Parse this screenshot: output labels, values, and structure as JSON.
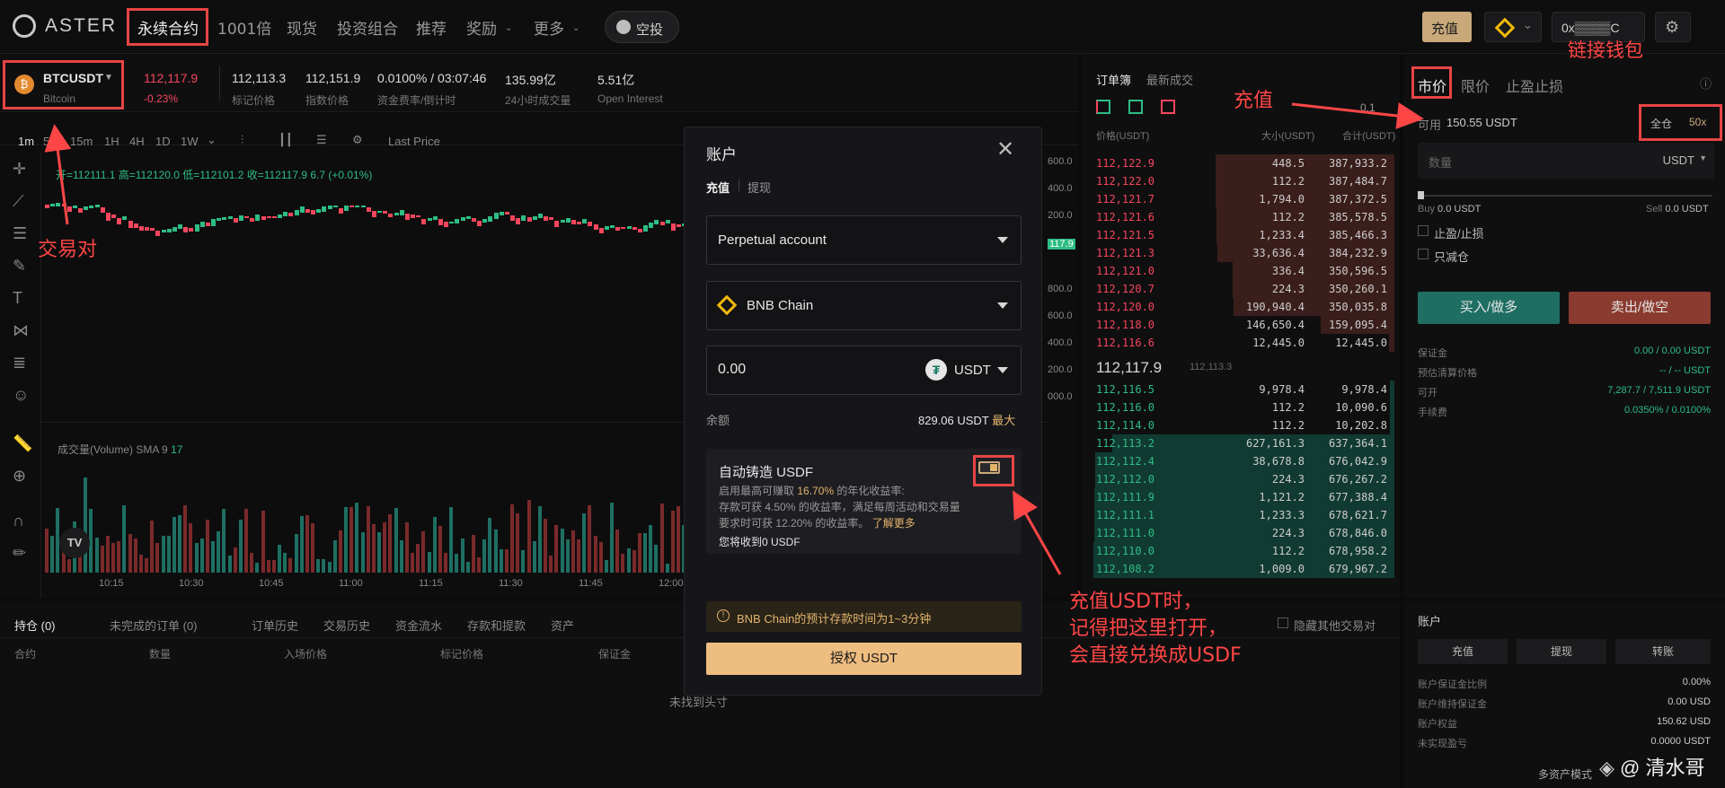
{
  "nav": {
    "logo": "ASTER",
    "items": [
      "永续合约",
      "1001倍",
      "现货",
      "投资组合",
      "推荐",
      "奖励",
      "更多"
    ],
    "airdrop": "空投",
    "deposit": "充值",
    "wallet": "0x▒▒▒▒C"
  },
  "ticker": {
    "symbol": "BTCUSDT",
    "name": "Bitcoin",
    "price": "112,117.9",
    "change": "-0.23%",
    "mark": "112,113.3",
    "mark_label": "标记价格",
    "index": "112,151.9",
    "index_label": "指数价格",
    "funding": "0.0100% / 03:07:46",
    "funding_label": "资金费率/倒计时",
    "vol": "135.99亿",
    "vol_label": "24小时成交量",
    "oi": "5.51亿",
    "oi_label": "Open Interest"
  },
  "chart": {
    "intervals": [
      "1m",
      "5m",
      "15m",
      "1H",
      "4H",
      "1D",
      "1W"
    ],
    "last_price": "Last Price",
    "ohlc": "开=112111.1 高=112120.0 低=112101.2 收=112117.9 6.7 (+0.01%)",
    "volume_label": "成交量(Volume)",
    "sma": "SMA 9",
    "sma_val": "17",
    "times": [
      "10:15",
      "10:30",
      "10:45",
      "11:00",
      "11:15",
      "11:30",
      "11:45",
      "12:00"
    ],
    "prices": [
      "600.0",
      "400.0",
      "200.0",
      "117.9",
      "800.0",
      "600.0",
      "400.0",
      "200.0",
      "000.0"
    ]
  },
  "orderbook": {
    "tabs": [
      "订单簿",
      "最新成交"
    ],
    "precision": "0.1",
    "headers": [
      "价格(USDT)",
      "大小(USDT)",
      "合计(USDT)"
    ],
    "asks": [
      [
        "112,122.9",
        "448.5",
        "387,933.2"
      ],
      [
        "112,122.0",
        "112.2",
        "387,484.7"
      ],
      [
        "112,121.7",
        "1,794.0",
        "387,372.5"
      ],
      [
        "112,121.6",
        "112.2",
        "385,578.5"
      ],
      [
        "112,121.5",
        "1,233.4",
        "385,466.3"
      ],
      [
        "112,121.3",
        "33,636.4",
        "384,232.9"
      ],
      [
        "112,121.0",
        "336.4",
        "350,596.5"
      ],
      [
        "112,120.7",
        "224.3",
        "350,260.1"
      ],
      [
        "112,120.0",
        "190,940.4",
        "350,035.8"
      ],
      [
        "112,118.0",
        "146,650.4",
        "159,095.4"
      ],
      [
        "112,116.6",
        "12,445.0",
        "12,445.0"
      ]
    ],
    "mid": "112,117.9",
    "mid_mark": "112,113.3",
    "bids": [
      [
        "112,116.5",
        "9,978.4",
        "9,978.4"
      ],
      [
        "112,116.0",
        "112.2",
        "10,090.6"
      ],
      [
        "112,114.0",
        "112.2",
        "10,202.8"
      ],
      [
        "112,113.2",
        "627,161.3",
        "637,364.1"
      ],
      [
        "112,112.4",
        "38,678.8",
        "676,042.9"
      ],
      [
        "112,112.0",
        "224.3",
        "676,267.2"
      ],
      [
        "112,111.9",
        "1,121.2",
        "677,388.4"
      ],
      [
        "112,111.1",
        "1,233.3",
        "678,621.7"
      ],
      [
        "112,111.0",
        "224.3",
        "678,846.0"
      ],
      [
        "112,110.0",
        "112.2",
        "678,958.2"
      ],
      [
        "112,108.2",
        "1,009.0",
        "679,967.2"
      ]
    ]
  },
  "trade": {
    "tabs": [
      "市价",
      "限价",
      "止盈止损"
    ],
    "available_label": "可用",
    "available": "150.55 USDT",
    "margin_mode": "全仓",
    "leverage": "50x",
    "qty_placeholder": "数量",
    "unit": "USDT",
    "buy_label": "Buy",
    "buy_val": "0.0 USDT",
    "sell_label": "Sell",
    "sell_val": "0.0 USDT",
    "tpsl": "止盈/止损",
    "reduce": "只减仓",
    "buy_btn": "买入/做多",
    "sell_btn": "卖出/做空",
    "info": [
      [
        "保证金",
        "0.00 / 0.00 USDT"
      ],
      [
        "预估清算价格",
        "-- / -- USDT"
      ],
      [
        "可开",
        "7,287.7 / 7,511.9 USDT"
      ],
      [
        "手续费",
        "0.0350% / 0.0100%"
      ]
    ]
  },
  "positions": {
    "tabs": [
      "持仓 (0)",
      "未完成的订单 (0)",
      "订单历史",
      "交易历史",
      "资金流水",
      "存款和提款",
      "资产"
    ],
    "hide": "隐藏其他交易对",
    "cols": [
      "合约",
      "数量",
      "入场价格",
      "标记价格",
      "保证金"
    ],
    "empty": "未找到头寸"
  },
  "account": {
    "title": "账户",
    "buttons": [
      "充值",
      "提现",
      "转账"
    ],
    "rows": [
      [
        "账户保证金比例",
        "0.00%"
      ],
      [
        "账户维持保证金",
        "0.00 USD"
      ],
      [
        "账户权益",
        "150.62 USD"
      ],
      [
        "未实现盈亏",
        "0.0000 USDT"
      ]
    ],
    "mode": "多资产模式"
  },
  "modal": {
    "title": "账户",
    "tab_deposit": "充值",
    "tab_withdraw": "提现",
    "account": "Perpetual account",
    "chain": "BNB Chain",
    "amount": "0.00",
    "token": "USDT",
    "balance_label": "余额",
    "balance": "829.06 USDT",
    "max": "最大",
    "mint_title": "自动铸造 USDF",
    "mint_desc1a": "启用最高可赚取 ",
    "mint_rate": "16.70%",
    "mint_desc1b": " 的年化收益率:",
    "mint_desc2": "存款可获 4.50% 的收益率，满足每周活动和交易量",
    "mint_desc3": "要求时可获 12.20% 的收益率。",
    "learn": "了解更多",
    "receive": "您将收到0 USDF",
    "notice": "BNB Chain的预计存款时间为1~3分钟",
    "authorize": "授权 USDT"
  },
  "annotations": {
    "pair": "交易对",
    "deposit": "充值",
    "wallet": "链接钱包",
    "usdt1": "充值USDT时，",
    "usdt2": "记得把这里打开，",
    "usdt3": "会直接兑换成USDF",
    "watermark": "@ 清水哥"
  }
}
